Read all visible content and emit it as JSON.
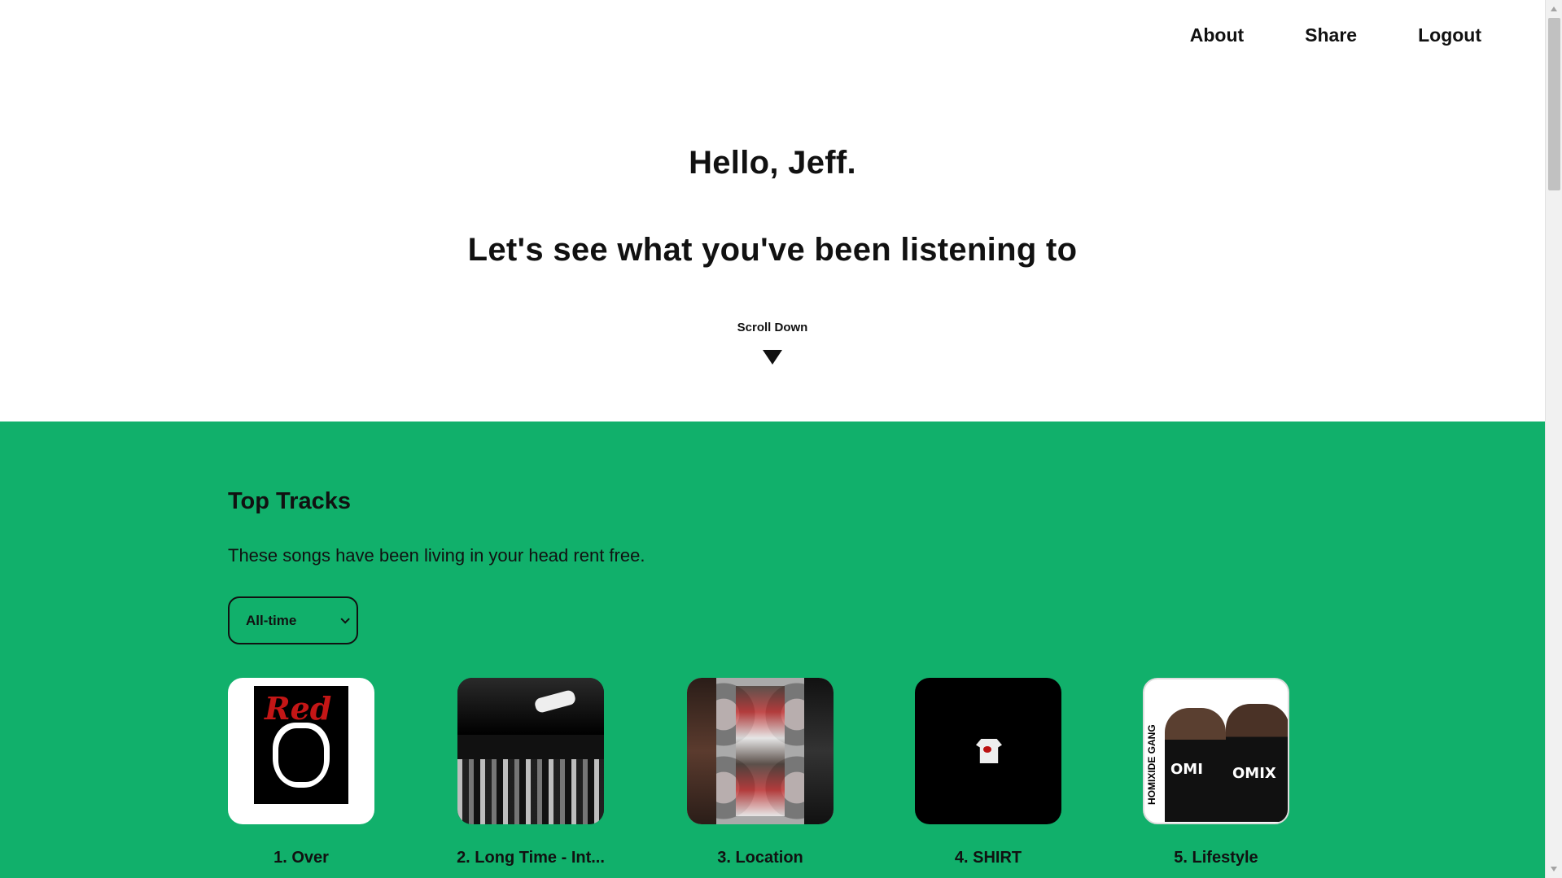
{
  "nav": {
    "items": [
      {
        "label": "About"
      },
      {
        "label": "Share"
      },
      {
        "label": "Logout"
      }
    ]
  },
  "hero": {
    "greeting": "Hello, Jeff.",
    "subtitle": "Let's see what you've been listening to",
    "scroll_label": "Scroll Down"
  },
  "top_tracks": {
    "title": "Top Tracks",
    "description": "These songs have been living in your head rent free.",
    "range_select": {
      "selected": "All-time"
    },
    "items": [
      {
        "label": "1. Over"
      },
      {
        "label": "2. Long Time - Int..."
      },
      {
        "label": "3. Location"
      },
      {
        "label": "4. SHIRT"
      },
      {
        "label": "5. Lifestyle"
      }
    ]
  },
  "colors": {
    "accent_green": "#11b06b",
    "text": "#111111",
    "background": "#ffffff"
  },
  "icons": [
    "down-triangle-icon",
    "chevron-down-icon",
    "scroll-up-arrow-icon",
    "scroll-down-arrow-icon"
  ],
  "cover_art": {
    "c1_text": "Red",
    "c5_side_text": "HOMIXIDE GANG",
    "c5_shirt_text_1": "OMI",
    "c5_shirt_text_2": "OMIX"
  }
}
